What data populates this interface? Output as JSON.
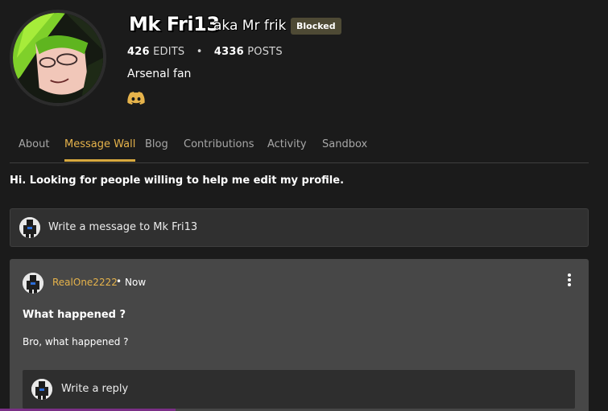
{
  "profile": {
    "username": "Mk Fri13",
    "aka": "aka Mr frik",
    "status_badge": "Blocked",
    "edits_count": "426",
    "edits_label": "EDITS",
    "stats_separator": "•",
    "posts_count": "4336",
    "posts_label": "POSTS",
    "bio": "Arsenal fan",
    "social_icon": "discord-icon"
  },
  "tabs": [
    {
      "label": "About",
      "active": false
    },
    {
      "label": "Message Wall",
      "active": true
    },
    {
      "label": "Blog",
      "active": false
    },
    {
      "label": "Contributions",
      "active": false
    },
    {
      "label": "Activity",
      "active": false
    },
    {
      "label": "Sandbox",
      "active": false
    }
  ],
  "wall": {
    "greeting": "Hi. Looking for people willing to help me edit my profile.",
    "compose_placeholder": "Write a message to Mk Fri13"
  },
  "post": {
    "author": "RealOne2222",
    "separator": "•",
    "time": "Now",
    "title": "What happened ?",
    "body": "Bro, what happened ?",
    "reply_placeholder": "Write a reply",
    "menu_icon": "more-vertical-icon"
  },
  "colors": {
    "background": "#1b1b1b",
    "accent": "#e6b34b",
    "badge": "#4e4a35",
    "card": "#474747"
  }
}
